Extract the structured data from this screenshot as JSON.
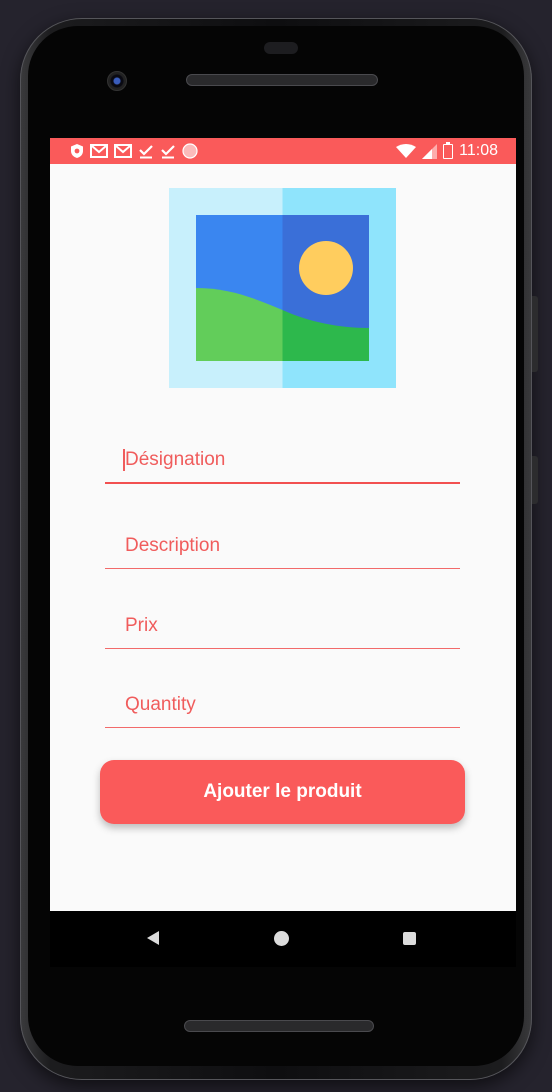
{
  "status_bar": {
    "time": "11:08",
    "notification_icons": [
      "shield-icon",
      "gmail-icon",
      "gmail-icon",
      "download-done-icon",
      "download-done-icon",
      "record-dot-icon"
    ],
    "system_icons": [
      "wifi-icon",
      "signal-icon",
      "battery-charging-icon"
    ],
    "background_color": "#fa5a5a"
  },
  "product_image": {
    "icon": "image-placeholder-icon",
    "colors": {
      "frame_left": "#c8f0fc",
      "frame_right": "#8fe4fc",
      "sky_left": "#3a86f0",
      "sky_right": "#3a6fd8",
      "sun": "#ffcd5e",
      "hill_left": "#62cd5a",
      "hill_right": "#2db84c"
    }
  },
  "form": {
    "designation_placeholder": "Désignation",
    "description_placeholder": "Description",
    "price_placeholder": "Prix",
    "quantity_placeholder": "Quantity",
    "submit_label": "Ajouter le produit"
  },
  "theme": {
    "accent": "#fa5a5a",
    "screen_background": "#fafafa"
  },
  "nav_bar": {
    "icons": [
      "back-icon",
      "home-icon",
      "recent-apps-icon"
    ]
  }
}
